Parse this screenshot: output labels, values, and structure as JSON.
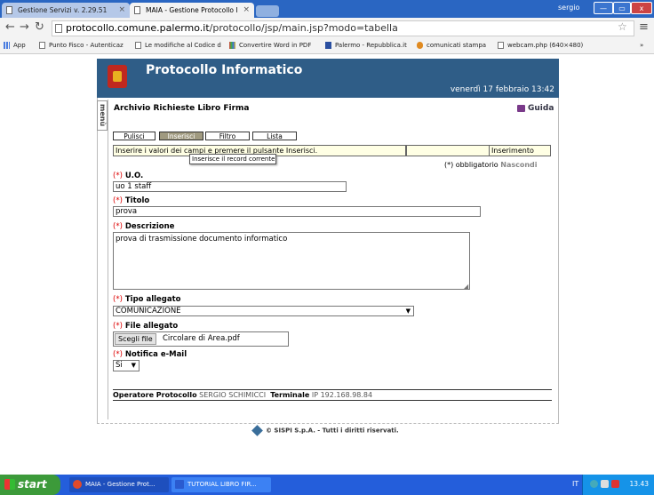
{
  "browser": {
    "tabs": [
      {
        "title": "Gestione Servizi v. 2.29.51",
        "active": false
      },
      {
        "title": "MAIA - Gestione Protocollo I",
        "active": true
      }
    ],
    "window_user": "sergio",
    "window_buttons": [
      "—",
      "▭",
      "x"
    ],
    "url_domain": "protocollo.comune.palermo.it",
    "url_path": "/protocollo/jsp/main.jsp?modo=tabella",
    "bookmarks": [
      "App",
      "Punto Fisco - Autenticaz",
      "Le modifiche al Codice d",
      "Convertire Word in PDF",
      "Palermo - Repubblica.it",
      "comunicati stampa",
      "webcam.php (640×480)"
    ],
    "bookmarks_more": "»"
  },
  "header": {
    "title": "Protocollo Informatico",
    "date": "venerdì 17 febbraio 13:42"
  },
  "menu_tab": "menù",
  "archive_title": "Archivio Richieste Libro Firma",
  "guide_label": "Guida",
  "toolbar": {
    "buttons": [
      "Pulisci",
      "Inserisci",
      "Filtro",
      "Lista"
    ]
  },
  "message": "Inserire i valori dei campi e premere il pulsante Inserisci.",
  "mode": "Inserimento",
  "tooltip": "Inserisce il record corrente",
  "required_note": "(*) obbligatorio",
  "hide_label": "Nascondi",
  "required_mark": "(*)",
  "form": {
    "uo": {
      "label": "U.O.",
      "value": "uo 1 staff"
    },
    "titolo": {
      "label": "Titolo",
      "value": "prova"
    },
    "descrizione": {
      "label": "Descrizione",
      "value": "prova di trasmissione documento informatico"
    },
    "tipo_allegato": {
      "label": "Tipo allegato",
      "value": "COMUNICAZIONE"
    },
    "file_allegato": {
      "label": "File allegato",
      "button": "Scegli file",
      "value": "Circolare di Area.pdf"
    },
    "notifica": {
      "label": "Notifica e-Mail",
      "value": "Si"
    }
  },
  "operator": {
    "label": "Operatore Protocollo",
    "name": "SERGIO SCHIMICCI",
    "terminal_label": "Terminale",
    "terminal_value": "IP 192.168.98.84"
  },
  "footer": "© SISPI S.p.A. - Tutti i diritti riservati.",
  "taskbar": {
    "start": "start",
    "tasks": [
      "MAIA - Gestione Prot...",
      "TUTORIAL LIBRO FIR..."
    ],
    "lang": "IT",
    "clock": "13.43"
  },
  "colors": {
    "header_bg": "#2f5d87",
    "taskbar_bg": "#245edb",
    "required": "#dd0000",
    "selected_button": "#a09a80"
  }
}
